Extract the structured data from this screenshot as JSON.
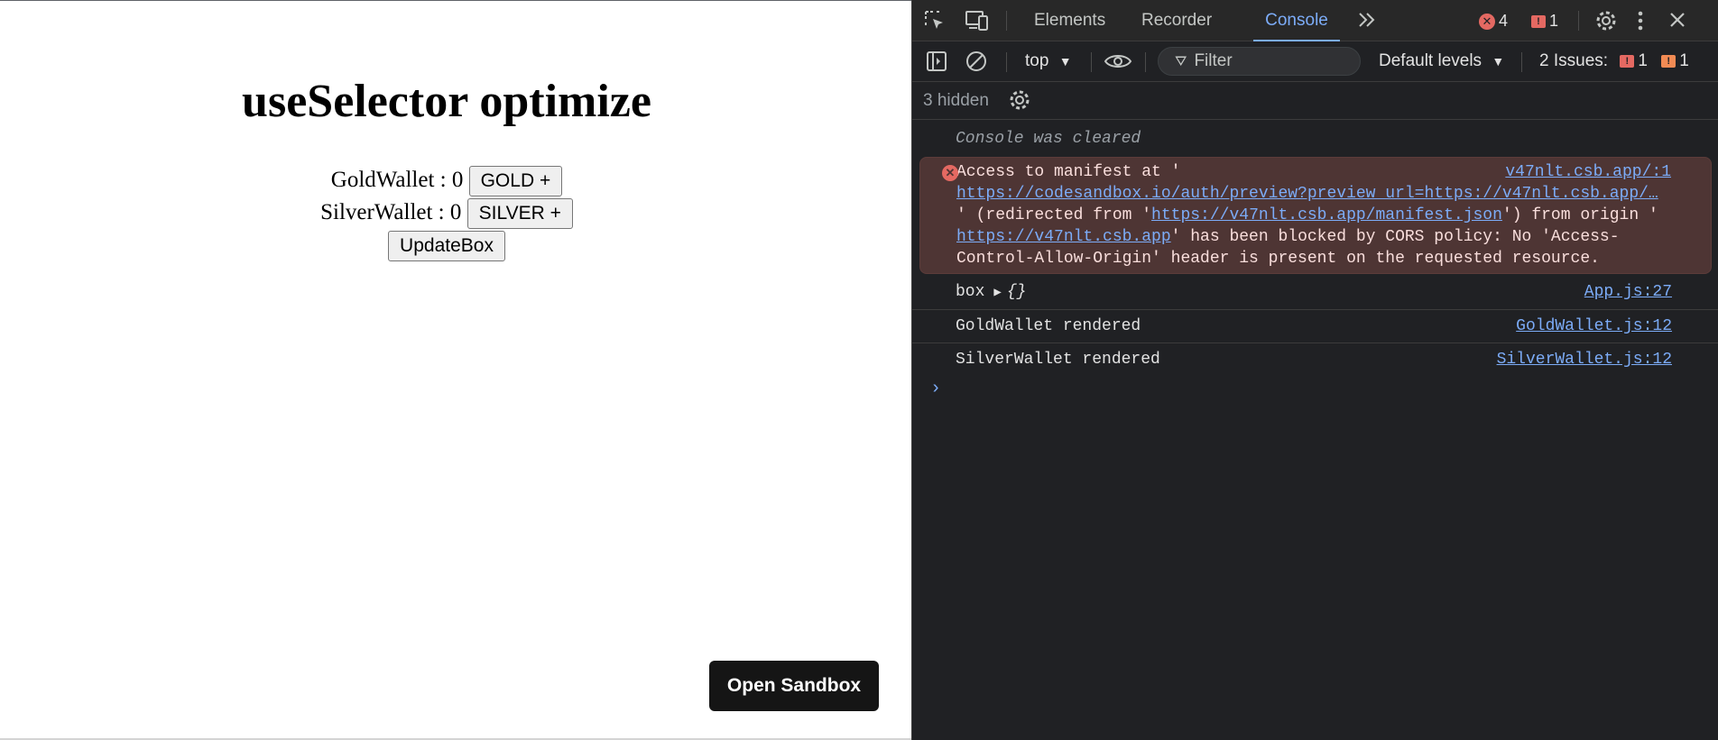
{
  "app": {
    "title": "useSelector optimize",
    "gold_label": "GoldWallet : 0",
    "gold_button": "GOLD +",
    "silver_label": "SilverWallet : 0",
    "silver_button": "SILVER +",
    "update_button": "UpdateBox",
    "open_sandbox": "Open Sandbox"
  },
  "devtools": {
    "tabs": [
      {
        "label": "Elements"
      },
      {
        "label": "Recorder"
      },
      {
        "label": "Console"
      }
    ],
    "error_count": "4",
    "issue_flag_count": "1",
    "toolbar": {
      "context": "top",
      "filter_placeholder": "Filter",
      "default_levels": "Default levels",
      "issues_label": "2 Issues:",
      "issues_error": "1",
      "issues_warning": "1"
    },
    "hidden": "3 hidden",
    "console": {
      "cleared": "Console was cleared",
      "error": {
        "source": "v47nlt.csb.app/:1",
        "line1": "Access to manifest at '",
        "url1": "https://codesandbox.io/auth/preview?preview_url=https://v47nlt.csb.app/…",
        "line3_a": "' (redirected from '",
        "url2": "https://v47nlt.csb.app/manifest.json",
        "line3_b": "') from origin '",
        "url3": "https://v47nlt.csb.app",
        "line4": "' has been blocked by CORS policy: No 'Access-",
        "line5": "Control-Allow-Origin' header is present on the requested resource."
      },
      "logs": [
        {
          "text": "box",
          "obj": "{}",
          "source": "App.js:27"
        },
        {
          "text": "GoldWallet rendered",
          "source": "GoldWallet.js:12"
        },
        {
          "text": "SilverWallet rendered",
          "source": "SilverWallet.js:12"
        }
      ]
    }
  },
  "colors": {
    "devtools_bg": "#202124",
    "accent": "#7cacf8",
    "error_bg": "#4e3534",
    "error_red": "#e46962",
    "warning_orange": "#f28b54"
  }
}
